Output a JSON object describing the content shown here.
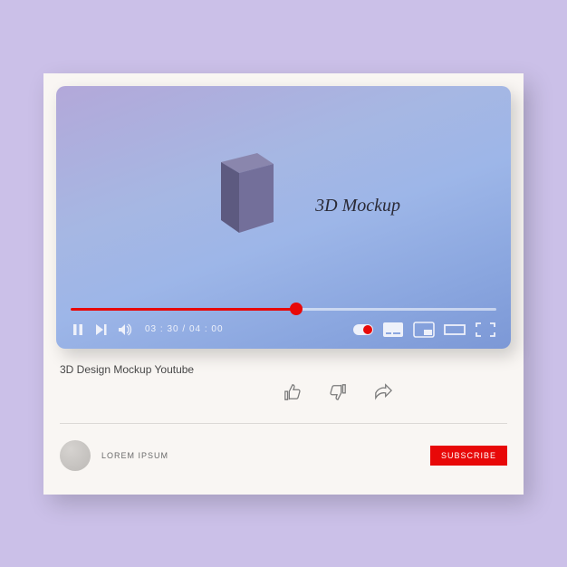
{
  "player": {
    "overlay_text": "3D Mockup",
    "time_current": "03 : 30",
    "time_total": "04 : 00",
    "progress_percent": 53
  },
  "video": {
    "title": "3D Design Mockup Youtube"
  },
  "channel": {
    "name": "LOREM IPSUM",
    "subscribe_label": "SUBSCRIBE"
  },
  "colors": {
    "accent": "#e80808",
    "page_bg": "#cbc0e8"
  }
}
